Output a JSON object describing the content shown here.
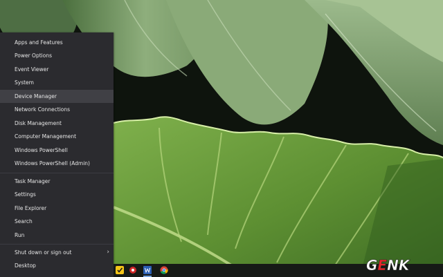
{
  "menu": {
    "group1": [
      {
        "label": "Apps and Features"
      },
      {
        "label": "Power Options"
      },
      {
        "label": "Event Viewer"
      },
      {
        "label": "System"
      },
      {
        "label": "Device Manager",
        "highlighted": true
      },
      {
        "label": "Network Connections"
      },
      {
        "label": "Disk Management"
      },
      {
        "label": "Computer Management"
      },
      {
        "label": "Windows PowerShell"
      },
      {
        "label": "Windows PowerShell (Admin)"
      }
    ],
    "group2": [
      {
        "label": "Task Manager"
      },
      {
        "label": "Settings"
      },
      {
        "label": "File Explorer"
      },
      {
        "label": "Search"
      },
      {
        "label": "Run"
      }
    ],
    "group3": [
      {
        "label": "Shut down or sign out",
        "has_submenu": true
      },
      {
        "label": "Desktop"
      }
    ],
    "submenu_glyph": "›"
  },
  "taskbar": {
    "icons": [
      "norton-icon",
      "media-icon",
      "word-icon",
      "chrome-icon"
    ]
  },
  "watermark": {
    "text": "GENK",
    "colors": {
      "g": "#ffffff",
      "e": "#e8262a",
      "nk": "#ffffff"
    }
  },
  "colors": {
    "menu_bg": "#2b2b2f",
    "menu_highlight": "#404045",
    "menu_text": "#e6e6e6",
    "leaf_green": "#6a9a3c",
    "taskbar_bg": "#161a16"
  }
}
